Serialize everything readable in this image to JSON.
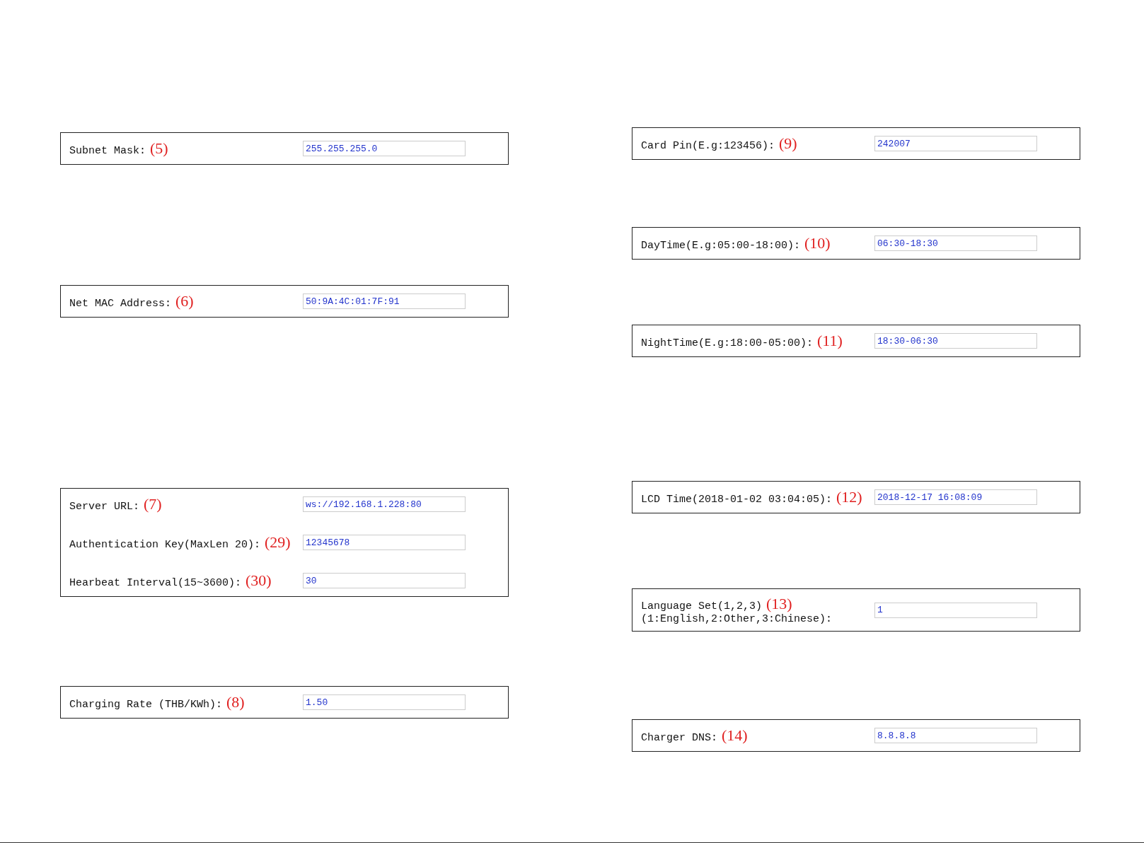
{
  "left_column": [
    {
      "rows": [
        {
          "label": "Subnet Mask:",
          "note": "(5)",
          "value": "255.255.255.0"
        }
      ]
    },
    {
      "rows": [
        {
          "label": "Net MAC Address:",
          "note": "(6)",
          "value": "50:9A:4C:01:7F:91"
        }
      ]
    },
    {
      "rows": [
        {
          "label": "Server URL:",
          "note": "(7)",
          "value": "ws://192.168.1.228:80"
        },
        {
          "label": "Authentication Key(MaxLen 20):",
          "note": "(29)",
          "value": "12345678"
        },
        {
          "label": "Hearbeat Interval(15~3600):",
          "note": "(30)",
          "value": "30"
        }
      ]
    },
    {
      "rows": [
        {
          "label": "Charging Rate (THB/KWh):",
          "note": "(8)",
          "value": "1.50"
        }
      ]
    }
  ],
  "right_column": [
    {
      "rows": [
        {
          "label": "Card Pin(E.g:123456):",
          "note": "(9)",
          "value": "242007"
        }
      ]
    },
    {
      "rows": [
        {
          "label": "DayTime(E.g:05:00-18:00):",
          "note": "(10)",
          "value": "06:30-18:30"
        }
      ]
    },
    {
      "rows": [
        {
          "label": "NightTime(E.g:18:00-05:00):",
          "note": "(11)",
          "value": "18:30-06:30"
        }
      ]
    },
    {
      "rows": [
        {
          "label": "LCD Time(2018-01-02 03:04:05):",
          "note": "(12)",
          "value": "2018-12-17 16:08:09"
        }
      ]
    },
    {
      "rows": [
        {
          "label": "Language Set(1,2,3)",
          "note": "(13)",
          "label_line_2": "(1:English,2:Other,3:Chinese):",
          "value": "1"
        }
      ]
    },
    {
      "rows": [
        {
          "label": "Charger DNS:",
          "note": "(14)",
          "value": "8.8.8.8"
        }
      ]
    }
  ]
}
